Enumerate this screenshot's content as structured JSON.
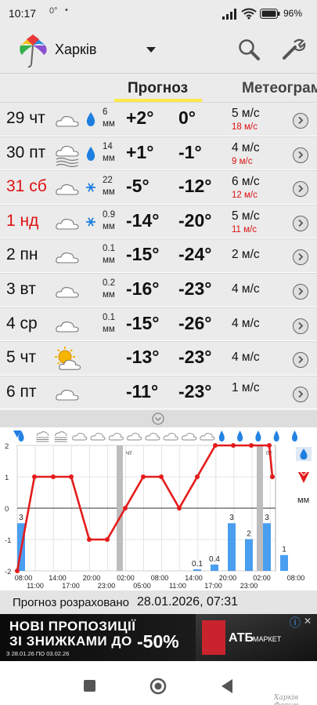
{
  "status_bar": {
    "time": "10:17",
    "temp_indicator": "0°",
    "dot": "•",
    "battery": "96"
  },
  "app_bar": {
    "city": "Харків",
    "icons": [
      "umbrella-logo-icon",
      "dropdown-arrow-icon",
      "search-icon",
      "wrench-settings-icon"
    ]
  },
  "tabs": [
    {
      "label": "Прогноз",
      "active": true
    },
    {
      "label": "Метеограма",
      "active": false
    }
  ],
  "days": [
    {
      "day": "29 чт",
      "weekend": false,
      "icon": "cloud-icon",
      "precip_icon": "drop-icon",
      "precip": "6\nмм",
      "tmax": "+2°",
      "tmin": "0°",
      "wind": "5 м/с",
      "gust": "18 м/с"
    },
    {
      "day": "30 пт",
      "weekend": false,
      "icon": "fog-cloud-icon",
      "precip_icon": "drop-icon",
      "precip": "14\nмм",
      "tmax": "+1°",
      "tmin": "-1°",
      "wind": "4 м/с",
      "gust": "9 м/с"
    },
    {
      "day": "31 сб",
      "weekend": true,
      "icon": "cloud-icon",
      "precip_icon": "snowflake-icon",
      "precip": "22\nмм",
      "tmax": "-5°",
      "tmin": "-12°",
      "wind": "6 м/с",
      "gust": "12 м/с"
    },
    {
      "day": "1 нд",
      "weekend": true,
      "icon": "cloud-icon",
      "precip_icon": "snowflake-icon",
      "precip": "0.9\nмм",
      "tmax": "-14°",
      "tmin": "-20°",
      "wind": "5 м/с",
      "gust": "11 м/с"
    },
    {
      "day": "2 пн",
      "weekend": false,
      "icon": "cloud-icon",
      "precip_icon": "",
      "precip": "0.1\nмм",
      "tmax": "-15°",
      "tmin": "-24°",
      "wind": "2 м/с",
      "gust": ""
    },
    {
      "day": "3 вт",
      "weekend": false,
      "icon": "cloud-icon",
      "precip_icon": "",
      "precip": "0.2\nмм",
      "tmax": "-16°",
      "tmin": "-23°",
      "wind": "4 м/с",
      "gust": ""
    },
    {
      "day": "4 ср",
      "weekend": false,
      "icon": "cloud-icon",
      "precip_icon": "",
      "precip": "0.1\nмм",
      "tmax": "-15°",
      "tmin": "-26°",
      "wind": "4 м/с",
      "gust": ""
    },
    {
      "day": "5 чт",
      "weekend": false,
      "icon": "sun-cloud-icon",
      "precip_icon": "",
      "precip": "",
      "tmax": "-13°",
      "tmin": "-23°",
      "wind": "4 м/с",
      "gust": ""
    },
    {
      "day": "6 пт",
      "weekend": false,
      "icon": "cloud-icon",
      "precip_icon": "",
      "precip": "",
      "tmax": "-11°",
      "tmin": "-23°",
      "wind": "1 м/с",
      "gust": ""
    }
  ],
  "chart_data": {
    "type": "line",
    "ylim": [
      -2,
      2
    ],
    "y_ticks": [
      "2",
      "1",
      "0",
      "-1",
      "-2"
    ],
    "x_ticks_top": [
      "08:00",
      "14:00",
      "20:00",
      "02:00",
      "08:00",
      "14:00",
      "20:00",
      "02:00",
      "08:00"
    ],
    "x_ticks_bottom": [
      "11:00",
      "17:00",
      "23:00",
      "05:00",
      "11:00",
      "17:00",
      "23:00"
    ],
    "day_markers": [
      "чт",
      "пт"
    ],
    "legend": {
      "precip_unit": "мм"
    },
    "sky_icons": [
      "drop-icon",
      "fog-icon",
      "fog-icon",
      "cloud-icon",
      "cloud-icon",
      "cloud-icon",
      "cloud-icon",
      "cloud-icon",
      "cloud-icon",
      "cloud-icon",
      "cloud-icon",
      "drop-icon",
      "drop-icon",
      "drop-icon",
      "drop-icon",
      "drop-icon"
    ],
    "series": [
      {
        "name": "wind_line",
        "x": [
          0,
          1,
          2,
          3,
          4,
          5,
          6,
          7,
          8,
          9,
          10,
          11,
          12,
          13,
          14,
          15,
          16
        ],
        "values": [
          -2,
          1,
          1,
          1,
          -1,
          -1,
          0,
          1,
          1,
          0,
          1,
          2,
          2,
          2,
          2,
          1,
          1
        ]
      },
      {
        "name": "precip_bars",
        "x": [
          0,
          11,
          12,
          13,
          14,
          15,
          16
        ],
        "values": [
          3,
          0.1,
          0.4,
          3,
          2,
          3,
          1
        ]
      }
    ],
    "bar_labels": [
      "3",
      "0.1",
      "0.4",
      "3",
      "2",
      "3",
      "1"
    ]
  },
  "forecast_calc": {
    "label": "Прогноз розраховано",
    "datetime": "28.01.2026, 07:31"
  },
  "ad": {
    "line1": "НОВІ ПРОПОЗИЦІЇ",
    "line2": "ЗІ ЗНИЖКАМИ ДО",
    "discount": "-50%",
    "dates": "З 28.01.26 ПО 03.02.26",
    "brand": "АТБ",
    "brand_sub": "МАРКЕТ",
    "info": "ⓘ",
    "close": "✕"
  },
  "watermark": "Харків Форум"
}
